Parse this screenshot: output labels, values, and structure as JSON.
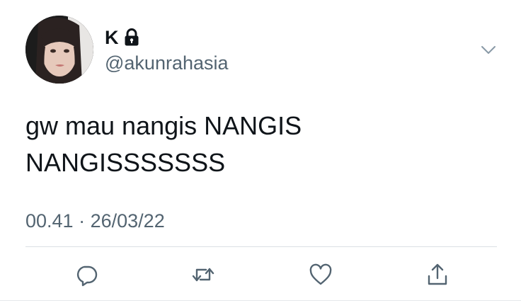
{
  "tweet": {
    "author": {
      "display_name": "K",
      "handle": "@akunrahasia",
      "protected_icon": "lock-icon",
      "avatar": "profile-photo"
    },
    "text_lines": [
      "gw mau nangis NANGIS",
      "NANGISSSSSSS"
    ],
    "time": "00.41",
    "separator": "·",
    "date": "26/03/22",
    "menu_icon": "chevron-down-icon",
    "actions": [
      {
        "icon": "reply-icon"
      },
      {
        "icon": "retweet-icon"
      },
      {
        "icon": "heart-icon"
      },
      {
        "icon": "share-icon"
      }
    ]
  },
  "colors": {
    "text_primary": "#0f1419",
    "text_secondary": "#536471",
    "icon": "#536471",
    "divider": "#dbe0e4",
    "background": "#ffffff"
  }
}
